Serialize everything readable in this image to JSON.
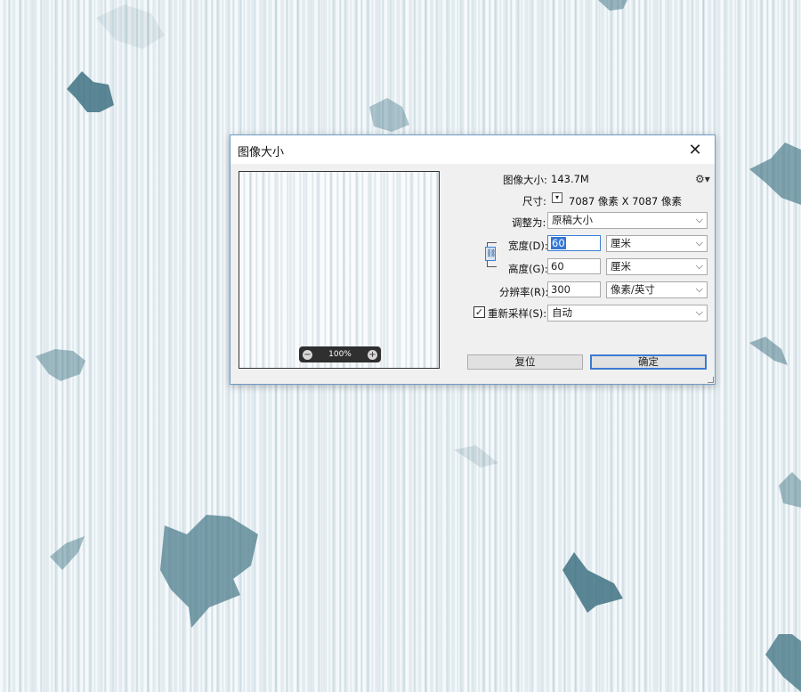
{
  "dialog": {
    "title": "图像大小",
    "close_glyph": "✕",
    "image_size_label": "图像大小:",
    "image_size_value": "143.7M",
    "dimensions_label": "尺寸:",
    "dimensions_value": "7087 像素  X  7087 像素",
    "fit_to_label": "调整为:",
    "fit_to_value": "原稿大小",
    "width_label": "宽度(D):",
    "width_value": "60",
    "width_unit": "厘米",
    "height_label": "高度(G):",
    "height_value": "60",
    "height_unit": "厘米",
    "resolution_label": "分辨率(R):",
    "resolution_value": "300",
    "resolution_unit": "像素/英寸",
    "resample_label": "重新采样(S):",
    "resample_checked": true,
    "resample_value": "自动",
    "reset_button": "复位",
    "ok_button": "确定",
    "zoom_level": "100%"
  },
  "icons": {
    "gear": "gear-icon",
    "link": "link-icon",
    "zoom_out": "zoom-out-icon",
    "zoom_in": "zoom-in-icon",
    "dropdown": "chevron-down-icon"
  },
  "colors": {
    "accent": "#3a7ad0",
    "selection": "#3477d6",
    "dialog_bg": "#f0f0f0",
    "background_teal": "#4f7f8f"
  }
}
